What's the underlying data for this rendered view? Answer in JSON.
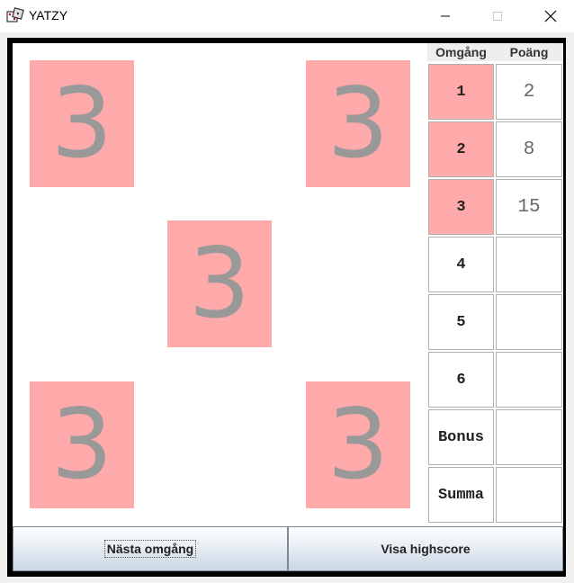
{
  "window": {
    "title": "YATZY",
    "icon": "app-dice-icon",
    "controls": [
      "minimize-icon",
      "maximize-icon",
      "close-icon"
    ]
  },
  "dice": [
    {
      "value": "3"
    },
    {
      "value": "3"
    },
    {
      "value": "3"
    },
    {
      "value": "3"
    },
    {
      "value": "3"
    }
  ],
  "scoreboard": {
    "header_round": "Omgång",
    "header_points": "Poäng",
    "rows": [
      {
        "round": "1",
        "points": "2",
        "played": true
      },
      {
        "round": "2",
        "points": "8",
        "played": true
      },
      {
        "round": "3",
        "points": "15",
        "played": true
      },
      {
        "round": "4",
        "points": "",
        "played": false
      },
      {
        "round": "5",
        "points": "",
        "played": false
      },
      {
        "round": "6",
        "points": "",
        "played": false
      },
      {
        "round": "Bonus",
        "points": "",
        "played": false
      },
      {
        "round": "Summa",
        "points": "",
        "played": false
      }
    ]
  },
  "buttons": {
    "next_round": "Nästa omgång",
    "show_highscore": "Visa highscore"
  },
  "colors": {
    "die_face": "#ffaaaa",
    "die_pip_text": "#999999",
    "played_round": "#ffaaaa",
    "frame": "#000000"
  }
}
